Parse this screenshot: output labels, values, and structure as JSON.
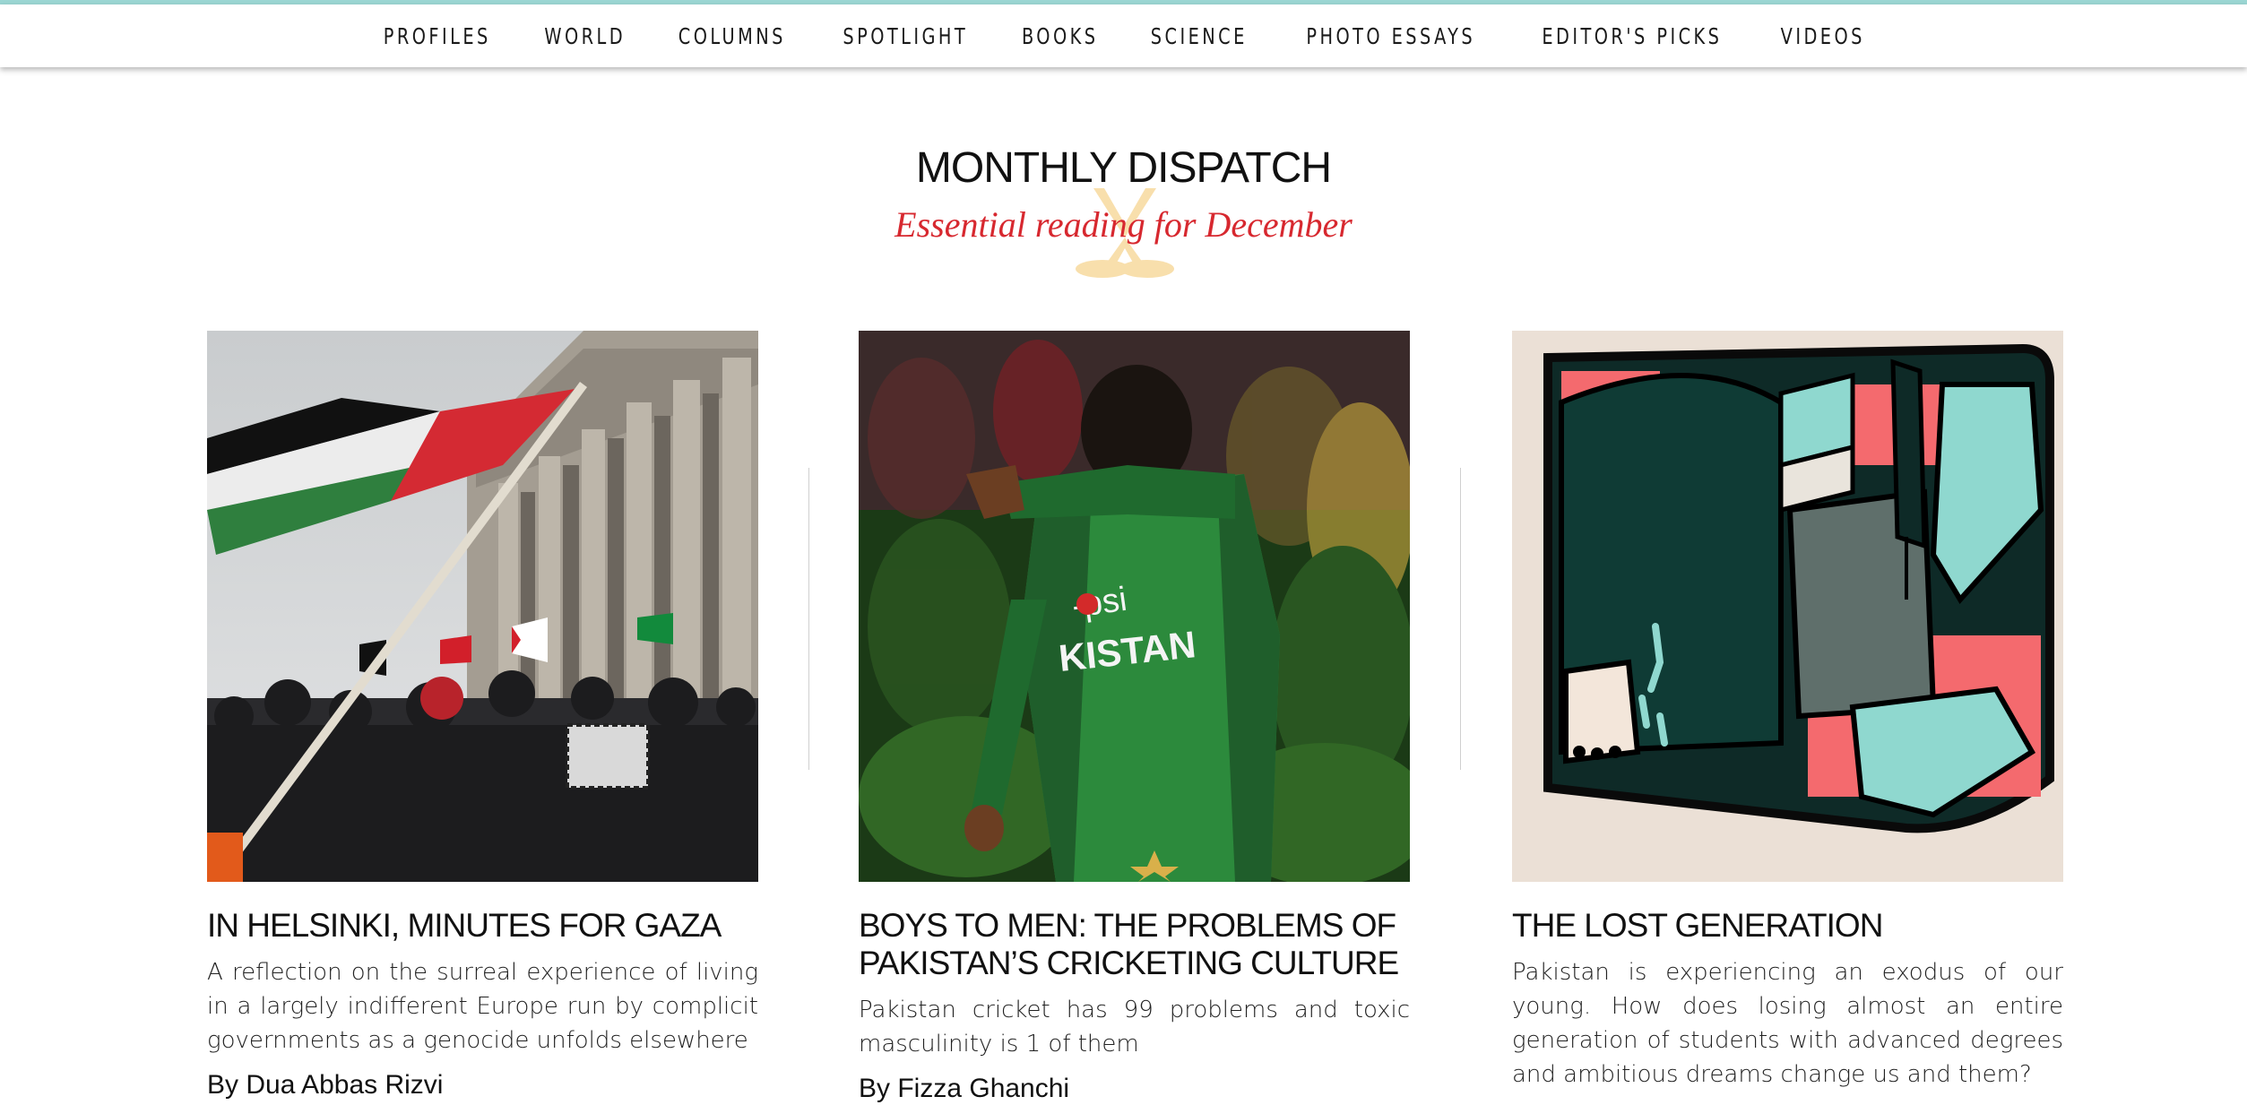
{
  "nav": {
    "items": [
      "PROFILES",
      "WORLD",
      "COLUMNS",
      "SPOTLIGHT",
      "BOOKS",
      "SCIENCE",
      "PHOTO ESSAYS",
      "EDITOR'S PICKS",
      "VIDEOS"
    ]
  },
  "section": {
    "title": "MONTHLY DISPATCH",
    "subtitle": "Essential reading for December"
  },
  "articles": [
    {
      "title": "IN HELSINKI, MINUTES FOR GAZA",
      "summary": "A reflection on the surreal experience of living in a largely indifferent Europe run by complicit governments as a genocide unfolds elsewhere",
      "byline": "By Dua Abbas Rizvi"
    },
    {
      "title": "BOYS TO MEN: THE PROBLEMS OF PAKISTAN’S CRICKETING CULTURE",
      "summary": "Pakistan cricket has 99 problems and toxic masculinity is 1 of them",
      "byline": "By Fizza Ghanchi"
    },
    {
      "title": "THE LOST GENERATION",
      "summary": "Pakistan is experiencing an exodus of our young. How does losing almost an entire generation of students with advanced degrees and ambitious dreams change us and them?",
      "byline": ""
    }
  ],
  "colors": {
    "accent": "#d7282f",
    "topline": "#9bd6d3",
    "divider": "#cfcfcf"
  }
}
